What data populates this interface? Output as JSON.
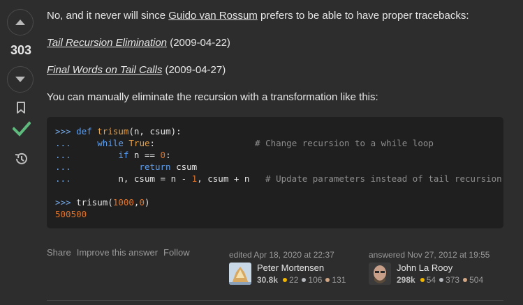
{
  "vote": {
    "count": "303",
    "up_icon": "arrow-up-icon",
    "down_icon": "arrow-down-icon",
    "bookmark_icon": "bookmark-icon",
    "accepted_icon": "check-icon",
    "accepted_color": "#5eba7d",
    "history_icon": "history-icon"
  },
  "answer": {
    "p1_before": "No, and it never will since ",
    "p1_link": "Guido van Rossum",
    "p1_after": " prefers to be able to have proper tracebacks:",
    "p2_link": "Tail Recursion Elimination",
    "p2_date": " (2009-04-22)",
    "p3_link": "Final Words on Tail Calls",
    "p3_date": " (2009-04-27)",
    "p4": "You can manually eliminate the recursion with a transformation like this:"
  },
  "code": {
    "l1_prompt": ">>>",
    "l1_kw": "def",
    "l1_fn": "trisum",
    "l1_rest": "(n, csum):",
    "l2_prompt": "...",
    "l2_indent": "     ",
    "l2_kw": "while",
    "l2_true": "True",
    "l2_rest": ":",
    "l2_pad": "                   ",
    "l2_comment": "# Change recursion to a while loop",
    "l3_prompt": "...",
    "l3_indent": "         ",
    "l3_kw": "if",
    "l3_rest": " n == ",
    "l3_num": "0",
    "l3_end": ":",
    "l4_prompt": "...",
    "l4_indent": "             ",
    "l4_kw": "return",
    "l4_rest": " csum",
    "l5_prompt": "...",
    "l5_indent": "         ",
    "l5_a": "n, csum = n - ",
    "l5_num": "1",
    "l5_b": ", csum + n   ",
    "l5_comment": "# Update parameters instead of tail recursion",
    "l6_prompt": ">>>",
    "l6_a": " trisum(",
    "l6_n1": "1000",
    "l6_c": ",",
    "l6_n2": "0",
    "l6_d": ")",
    "l7_output": "500500"
  },
  "footer": {
    "share": "Share",
    "improve": "Improve this answer",
    "follow": "Follow"
  },
  "editor": {
    "action": "edited Apr 18, 2020 at 22:37",
    "name": "Peter Mortensen",
    "rep": "30.8k",
    "gold": "22",
    "silver": "106",
    "bronze": "131"
  },
  "author": {
    "action": "answered Nov 27, 2012 at 19:55",
    "name": "John La Rooy",
    "rep": "298k",
    "gold": "54",
    "silver": "373",
    "bronze": "504"
  },
  "colors": {
    "gold": "#f1b600",
    "silver": "#b4b8bc",
    "bronze": "#d1a684"
  }
}
